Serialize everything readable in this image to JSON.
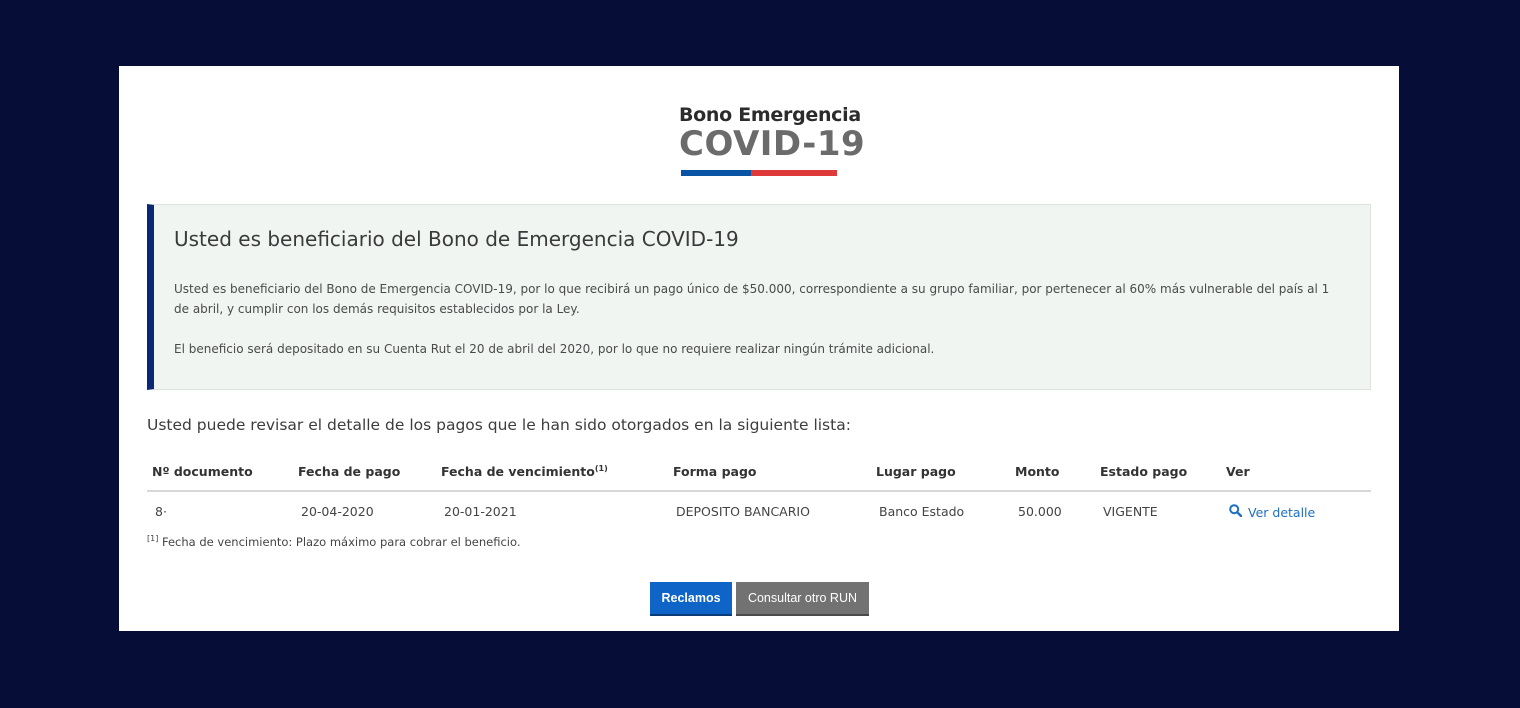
{
  "colors": {
    "backdrop": "#060e37",
    "modal_bg": "#ffffff",
    "notice_bg": "#f1f5f2",
    "notice_accent": "#0a2876",
    "flag_blue": "#0a54a6",
    "flag_red": "#de3a3a",
    "link": "#1e6fc0",
    "btn_primary": "#0f64c8",
    "btn_secondary": "#727272"
  },
  "logo": {
    "line1": "Bono Emergencia",
    "line2": "COVID-19"
  },
  "notice": {
    "title": "Usted es beneficiario del Bono de Emergencia COVID-19",
    "paragraph1": "Usted es beneficiario del Bono de Emergencia COVID-19, por lo que recibirá un pago único de $50.000, correspondiente a su grupo familiar, por pertenecer al 60% más vulnerable del país al 1 de abril, y cumplir con los demás requisitos establecidos por la Ley.",
    "paragraph2": "El beneficio será depositado en su Cuenta Rut el 20 de abril del 2020, por lo que no requiere realizar ningún trámite adicional."
  },
  "intro_text": "Usted puede revisar el detalle de los pagos que le han sido otorgados en la siguiente lista:",
  "table": {
    "headers": {
      "documento": "Nº documento",
      "fecha_pago": "Fecha de pago",
      "fecha_vencimiento": "Fecha de vencimiento",
      "fecha_vencimiento_sup": "(1)",
      "forma_pago": "Forma pago",
      "lugar_pago": "Lugar pago",
      "monto": "Monto",
      "estado_pago": "Estado pago",
      "ver": "Ver"
    },
    "rows": [
      {
        "documento": "8·",
        "fecha_pago": "20-04-2020",
        "fecha_vencimiento": "20-01-2021",
        "forma_pago": "DEPOSITO BANCARIO",
        "lugar_pago": "Banco Estado",
        "monto": "50.000",
        "estado_pago": "VIGENTE",
        "ver": "Ver detalle",
        "ver_icon": "search-icon"
      }
    ]
  },
  "footnote": {
    "marker": "[1]",
    "text": " Fecha de vencimiento: Plazo máximo para cobrar el beneficio."
  },
  "buttons": {
    "reclamos": "Reclamos",
    "consultar": "Consultar otro RUN"
  }
}
